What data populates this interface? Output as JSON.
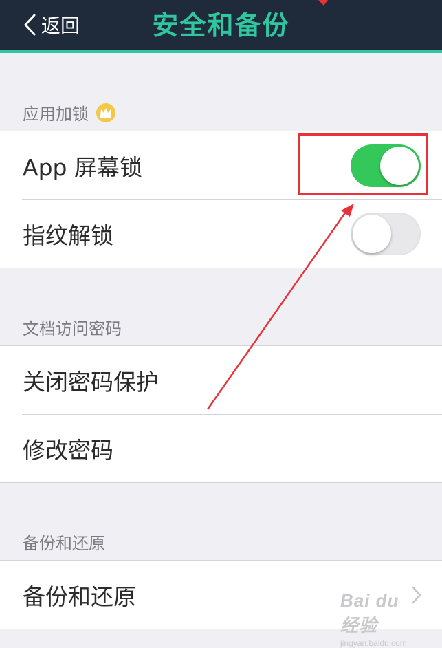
{
  "navbar": {
    "back_label": "返回",
    "title": "安全和备份",
    "background_color": "#1f2a3a",
    "accent_color": "#2fc6a0"
  },
  "sections": [
    {
      "header": "应用加锁",
      "header_icon": "crown-icon",
      "rows": [
        {
          "label": "App 屏幕锁",
          "control": "toggle",
          "state": "on"
        },
        {
          "label": "指纹解锁",
          "control": "toggle",
          "state": "off"
        }
      ]
    },
    {
      "header": "文档访问密码",
      "rows": [
        {
          "label": "关闭密码保护"
        },
        {
          "label": "修改密码"
        }
      ]
    },
    {
      "header": "备份和还原",
      "rows": [
        {
          "label": "备份和还原",
          "control": "chevron-right-icon"
        }
      ]
    }
  ],
  "annotation": {
    "highlight_color": "#e8323a",
    "points_to": "App 屏幕锁 toggle"
  },
  "watermark": {
    "main": "Bai du 经验",
    "sub": "jingyan.baidu.com"
  },
  "toggle_on_color": "#34c85a"
}
